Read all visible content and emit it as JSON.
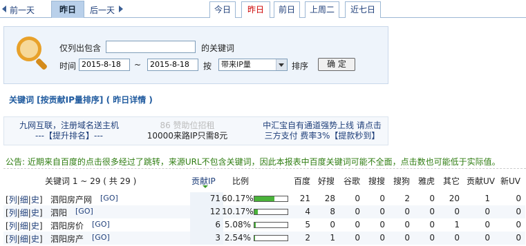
{
  "nav": {
    "prev": "前一天",
    "current": "昨日",
    "next": "后一天",
    "tabs": [
      {
        "label": "今日",
        "active": false
      },
      {
        "label": "昨日",
        "active": true
      },
      {
        "label": "前日",
        "active": false
      },
      {
        "label": "上周二",
        "active": false
      },
      {
        "label": "近七日",
        "active": false
      }
    ]
  },
  "search": {
    "only_list": "仅列出包含",
    "keyword_value": "",
    "keyword_suffix": "的关键词",
    "time_label": "时间",
    "date_from": "2015-8-18",
    "tilde": "~",
    "date_to": "2015-8-18",
    "by_label": "按",
    "sort_select": "带来IP量",
    "sort_label": "排序",
    "confirm": "确 定"
  },
  "title": "关键词 [按贡献IP量排序] ( 昨日详情 )",
  "ads": {
    "a1_line1": "九网互联，注册域名送主机",
    "a1_line2": "---【提升排名】---",
    "a2_line1": "86 赞助位招租",
    "a2_line2": "10000来路IP只需8元",
    "a3_line1": "中汇宝自有通道强势上线 请点击",
    "a3_line2": "三方支付 费率3%【提款秒到】"
  },
  "notice": "公告: 近期来自百度的点击很多经过了跳转，来源URL不包含关键词，因此本报表中百度关键词可能不全面，点击数也可能低于实际值。",
  "table": {
    "headers": {
      "keyword": "关键词 1 ~ 29 ( 共 29 )",
      "ip": "贡献IP",
      "ratio": "比例",
      "baidu": "百度",
      "haosou": "好搜",
      "google": "谷歌",
      "sousou": "搜搜",
      "sogou": "搜狗",
      "yahoo": "雅虎",
      "other": "其它",
      "uv": "贡献UV",
      "new_uv": "新UV"
    },
    "ops": {
      "list": "列",
      "detail": "细",
      "history": "史",
      "go": "[GO]"
    },
    "rows": [
      {
        "keyword": "泗阳房产网",
        "ip": "71",
        "ratio": "60.17%",
        "pct": 0.6017,
        "baidu": "21",
        "haosou": "28",
        "google": "0",
        "sousou": "0",
        "sogou": "2",
        "yahoo": "0",
        "other": "20",
        "uv": "1",
        "new_uv": "0"
      },
      {
        "keyword": "泗阳",
        "ip": "12",
        "ratio": "10.17%",
        "pct": 0.1017,
        "baidu": "4",
        "haosou": "8",
        "google": "0",
        "sousou": "0",
        "sogou": "0",
        "yahoo": "0",
        "other": "0",
        "uv": "0",
        "new_uv": "0"
      },
      {
        "keyword": "泗阳房价",
        "ip": "6",
        "ratio": "5.08%",
        "pct": 0.0508,
        "baidu": "5",
        "haosou": "0",
        "google": "0",
        "sousou": "0",
        "sogou": "0",
        "yahoo": "0",
        "other": "1",
        "uv": "0",
        "new_uv": "0"
      },
      {
        "keyword": "泗阳房产",
        "ip": "3",
        "ratio": "2.54%",
        "pct": 0.0254,
        "baidu": "2",
        "haosou": "1",
        "google": "0",
        "sousou": "0",
        "sogou": "0",
        "yahoo": "0",
        "other": "0",
        "uv": "0",
        "new_uv": "0"
      }
    ]
  },
  "colors": {
    "accent": "#1f5a9e",
    "notice": "#2f7d12",
    "bar": "#4ab33a",
    "active_tab": "#cc0000"
  }
}
